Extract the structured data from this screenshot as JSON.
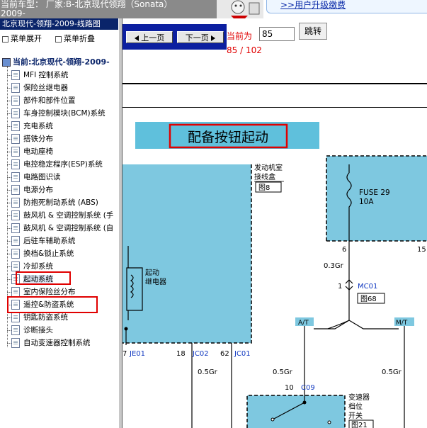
{
  "header": {
    "car_line1": "当前车型： 厂家:B-北京现代领翔（Sonata）",
    "car_line2": "2009-",
    "upgrade_link": ">>用户升级缴费"
  },
  "sidebar": {
    "title": "北京现代-领翔-2009-线路图",
    "expand_all": "菜单展开",
    "collapse_all": "菜单折叠",
    "current_label": "当前:北京现代-领翔-2009-",
    "items": [
      {
        "label": "MFI 控制系统"
      },
      {
        "label": "保险丝继电器"
      },
      {
        "label": "部件和部件位置"
      },
      {
        "label": "车身控制模块(BCM)系统"
      },
      {
        "label": "充电系统"
      },
      {
        "label": "搭铁分布"
      },
      {
        "label": "电动座椅"
      },
      {
        "label": "电控稳定程序(ESP)系统"
      },
      {
        "label": "电路图识读"
      },
      {
        "label": "电源分布"
      },
      {
        "label": "防抱死制动系统 (ABS)"
      },
      {
        "label": "鼓风机 & 空调控制系统 (手"
      },
      {
        "label": "鼓风机 & 空调控制系统 (自"
      },
      {
        "label": "后驻车辅助系统"
      },
      {
        "label": "换档&锁止系统"
      },
      {
        "label": "冷却系统"
      },
      {
        "label": "起动系统"
      },
      {
        "label": "室内保险丝分布"
      },
      {
        "label": "遥控&防盗系统"
      },
      {
        "label": "钥匙防盗系统"
      },
      {
        "label": "诊断接头"
      },
      {
        "label": "自动变速器控制系统"
      }
    ]
  },
  "toolbar": {
    "prev_label": "上一页",
    "next_label": "下一页",
    "current_label": "当前为",
    "page_value": "85",
    "jump_label": "跳转",
    "page_count": "85 / 102"
  },
  "diagram": {
    "title": "配备按钮起动",
    "engine_box_1": "发动机室",
    "engine_box_2": "接线盒",
    "engine_box_ref": "图8",
    "fuse_label": "FUSE 29",
    "fuse_amp": "10A",
    "relay_1": "起动",
    "relay_2": "继电器",
    "pin_6": "6",
    "pin_15": "15",
    "wire_03gr": "0.3Gr",
    "pin_1": "1",
    "conn_mc01": "MC01",
    "ref_68": "图68",
    "at_label": "A/T",
    "mt_label": "M/T",
    "pin_7": "7",
    "conn_je01": "JE01",
    "pin_18": "18",
    "conn_jc02": "JC02",
    "pin_62": "62",
    "conn_jc01": "JC01",
    "wire_05gr_a": "0.5Gr",
    "wire_05gr_b": "0.5Gr",
    "wire_05gr_c": "0.5Gr",
    "pin_10": "10",
    "conn_c09": "C09",
    "trans_1": "变速器",
    "trans_2": "档位",
    "trans_3": "开关",
    "ref_21": "图21"
  },
  "colors": {
    "diagram_fill": "#7ec8e0",
    "title_fill": "#5fc0dc",
    "highlight_red": "#e00000",
    "nav_blue": "#0c1fa0",
    "sidebar_title_bg": "#0a246a",
    "wire_blue": "#1038c0"
  }
}
